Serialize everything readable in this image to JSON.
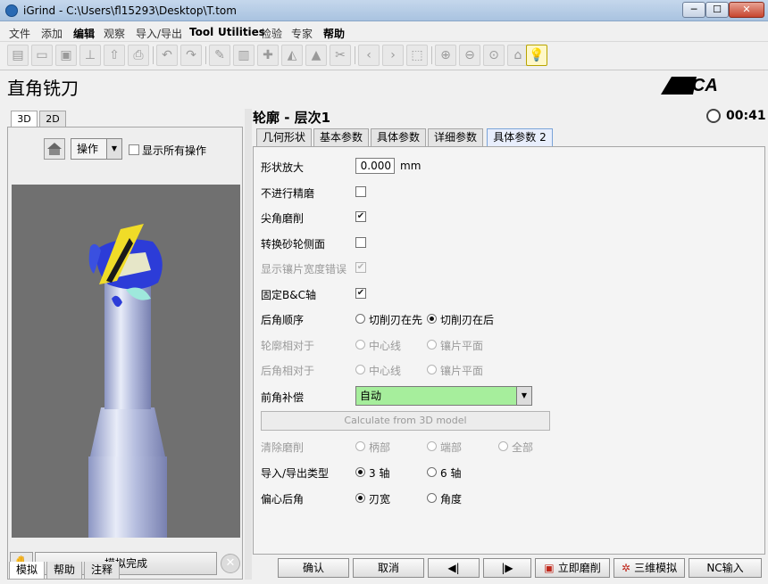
{
  "window": {
    "title": "iGrind - C:\\Users\\fl15293\\Desktop\\T.tom",
    "min": "─",
    "max": "☐",
    "close": "✕"
  },
  "menu": [
    "文件",
    "添加",
    "编辑",
    "观察",
    "导入/导出",
    "Tool",
    "Utilities",
    "检验",
    "专家",
    "帮助"
  ],
  "toolbar": {
    "icons": [
      "new-file-icon",
      "open-folder-icon",
      "save-icon",
      "brush-icon",
      "upload-icon",
      "print-icon",
      "undo-icon",
      "redo-icon",
      "edit-icon",
      "delete-icon",
      "add-icon",
      "wheel-icon",
      "tool-icon",
      "cut-icon",
      "arrow-left-icon",
      "arrow-right-icon",
      "select-box-icon",
      "zoom-in-icon",
      "zoom-out-icon",
      "zoom-fit-icon",
      "home-icon",
      "hint-bulb-icon"
    ]
  },
  "page": {
    "title": "直角铣刀",
    "logo": "ANCA"
  },
  "left": {
    "tabs": [
      "3D",
      "2D"
    ],
    "operation_combo": "操作",
    "show_all_label": "显示所有操作",
    "sim_button": "模拟完成",
    "bottom_tabs": [
      "模拟",
      "帮助",
      "注释"
    ]
  },
  "right": {
    "section_title": "轮廓 - 层次1",
    "timer": "00:41",
    "tabs": [
      "几何形状",
      "基本参数",
      "具体参数",
      "详细参数",
      "具体参数 2"
    ],
    "form": {
      "scale_label": "形状放大",
      "scale_value": "0.000",
      "scale_unit": "mm",
      "no_finish_label": "不进行精磨",
      "corner_grind_label": "尖角磨削",
      "switch_wheel_label": "转换砂轮侧面",
      "show_insert_err_label": "显示镶片宽度错误",
      "fix_bc_label": "固定B&C轴",
      "clearance_order_label": "后角顺序",
      "clearance_order_opt1": "切削刃在先",
      "clearance_order_opt2": "切削刃在后",
      "profile_rel_label": "轮廓相对于",
      "profile_rel_opt1": "中心线",
      "profile_rel_opt2": "镶片平面",
      "clearance_rel_label": "后角相对于",
      "clearance_rel_opt1": "中心线",
      "clearance_rel_opt2": "镶片平面",
      "rake_comp_label": "前角补偿",
      "rake_comp_value": "自动",
      "calc_button": "Calculate from 3D model",
      "clear_grind_label": "清除磨削",
      "clear_opt1": "柄部",
      "clear_opt2": "端部",
      "clear_opt3": "全部",
      "io_type_label": "导入/导出类型",
      "io_opt1": "3 轴",
      "io_opt2": "6 轴",
      "ecc_label": "偏心后角",
      "ecc_opt1": "刃宽",
      "ecc_opt2": "角度"
    },
    "buttons": {
      "ok": "确认",
      "cancel": "取消",
      "prev": "◀|",
      "next": "|▶",
      "grind_now": "立即磨削",
      "sim3d": "三维模拟",
      "nc_input": "NC输入"
    }
  }
}
